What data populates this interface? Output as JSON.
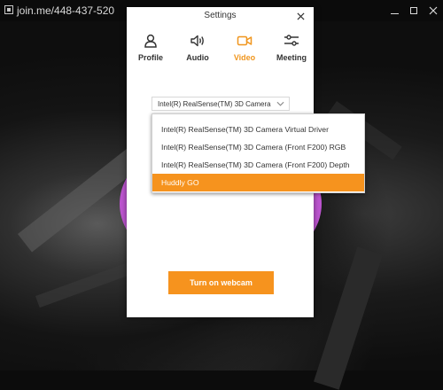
{
  "window": {
    "title": "join.me/448-437-520",
    "icons": {
      "app": "app-icon",
      "minimize": "minimize-icon",
      "maximize": "maximize-icon",
      "close": "close-icon"
    }
  },
  "dialog": {
    "title": "Settings",
    "close_icon": "close-icon",
    "tabs": [
      {
        "label": "Profile",
        "icon": "person-icon",
        "active": false
      },
      {
        "label": "Audio",
        "icon": "speaker-icon",
        "active": false
      },
      {
        "label": "Video",
        "icon": "video-camera-icon",
        "active": true
      },
      {
        "label": "Meeting",
        "icon": "sliders-icon",
        "active": false
      }
    ],
    "camera_select": {
      "value": "Intel(R) RealSense(TM) 3D Camera ..."
    },
    "webcam_button": "Turn on webcam"
  },
  "dropdown": {
    "options": [
      "Intel(R) RealSense(TM) 3D Camera Virtual Driver",
      "Intel(R) RealSense(TM) 3D Camera (Front F200) RGB",
      "Intel(R) RealSense(TM) 3D Camera (Front F200) Depth",
      "Huddly GO"
    ],
    "selected_index": 3
  },
  "colors": {
    "accent": "#f6931e",
    "preview_ring": "#bd55d0",
    "titlebar": "#0b0b0b"
  }
}
